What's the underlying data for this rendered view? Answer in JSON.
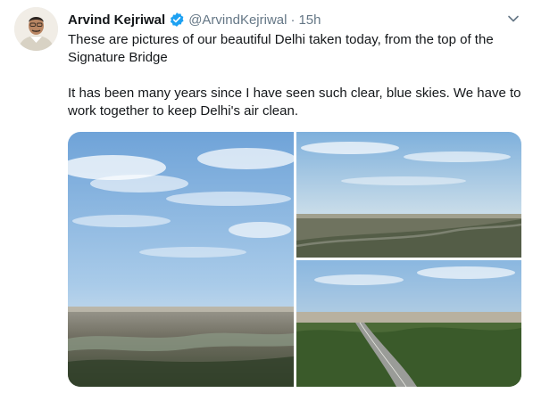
{
  "author": {
    "name": "Arvind Kejriwal",
    "handle": "@ArvindKejriwal",
    "separator": "·",
    "time": "15h",
    "verified": true
  },
  "tweet": {
    "paragraph1": "These are pictures of our beautiful Delhi taken today, from the top of the Signature Bridge",
    "paragraph2": "It has been many years since I have seen such clear, blue skies. We have to work together to keep Delhi's air clean."
  },
  "media": {
    "photo_count": 3
  },
  "colors": {
    "text": "#14171a",
    "secondary": "#657786",
    "verified": "#1da1f2"
  },
  "icons": {
    "verified": "verified-badge-icon",
    "menu": "chevron-down-icon"
  }
}
